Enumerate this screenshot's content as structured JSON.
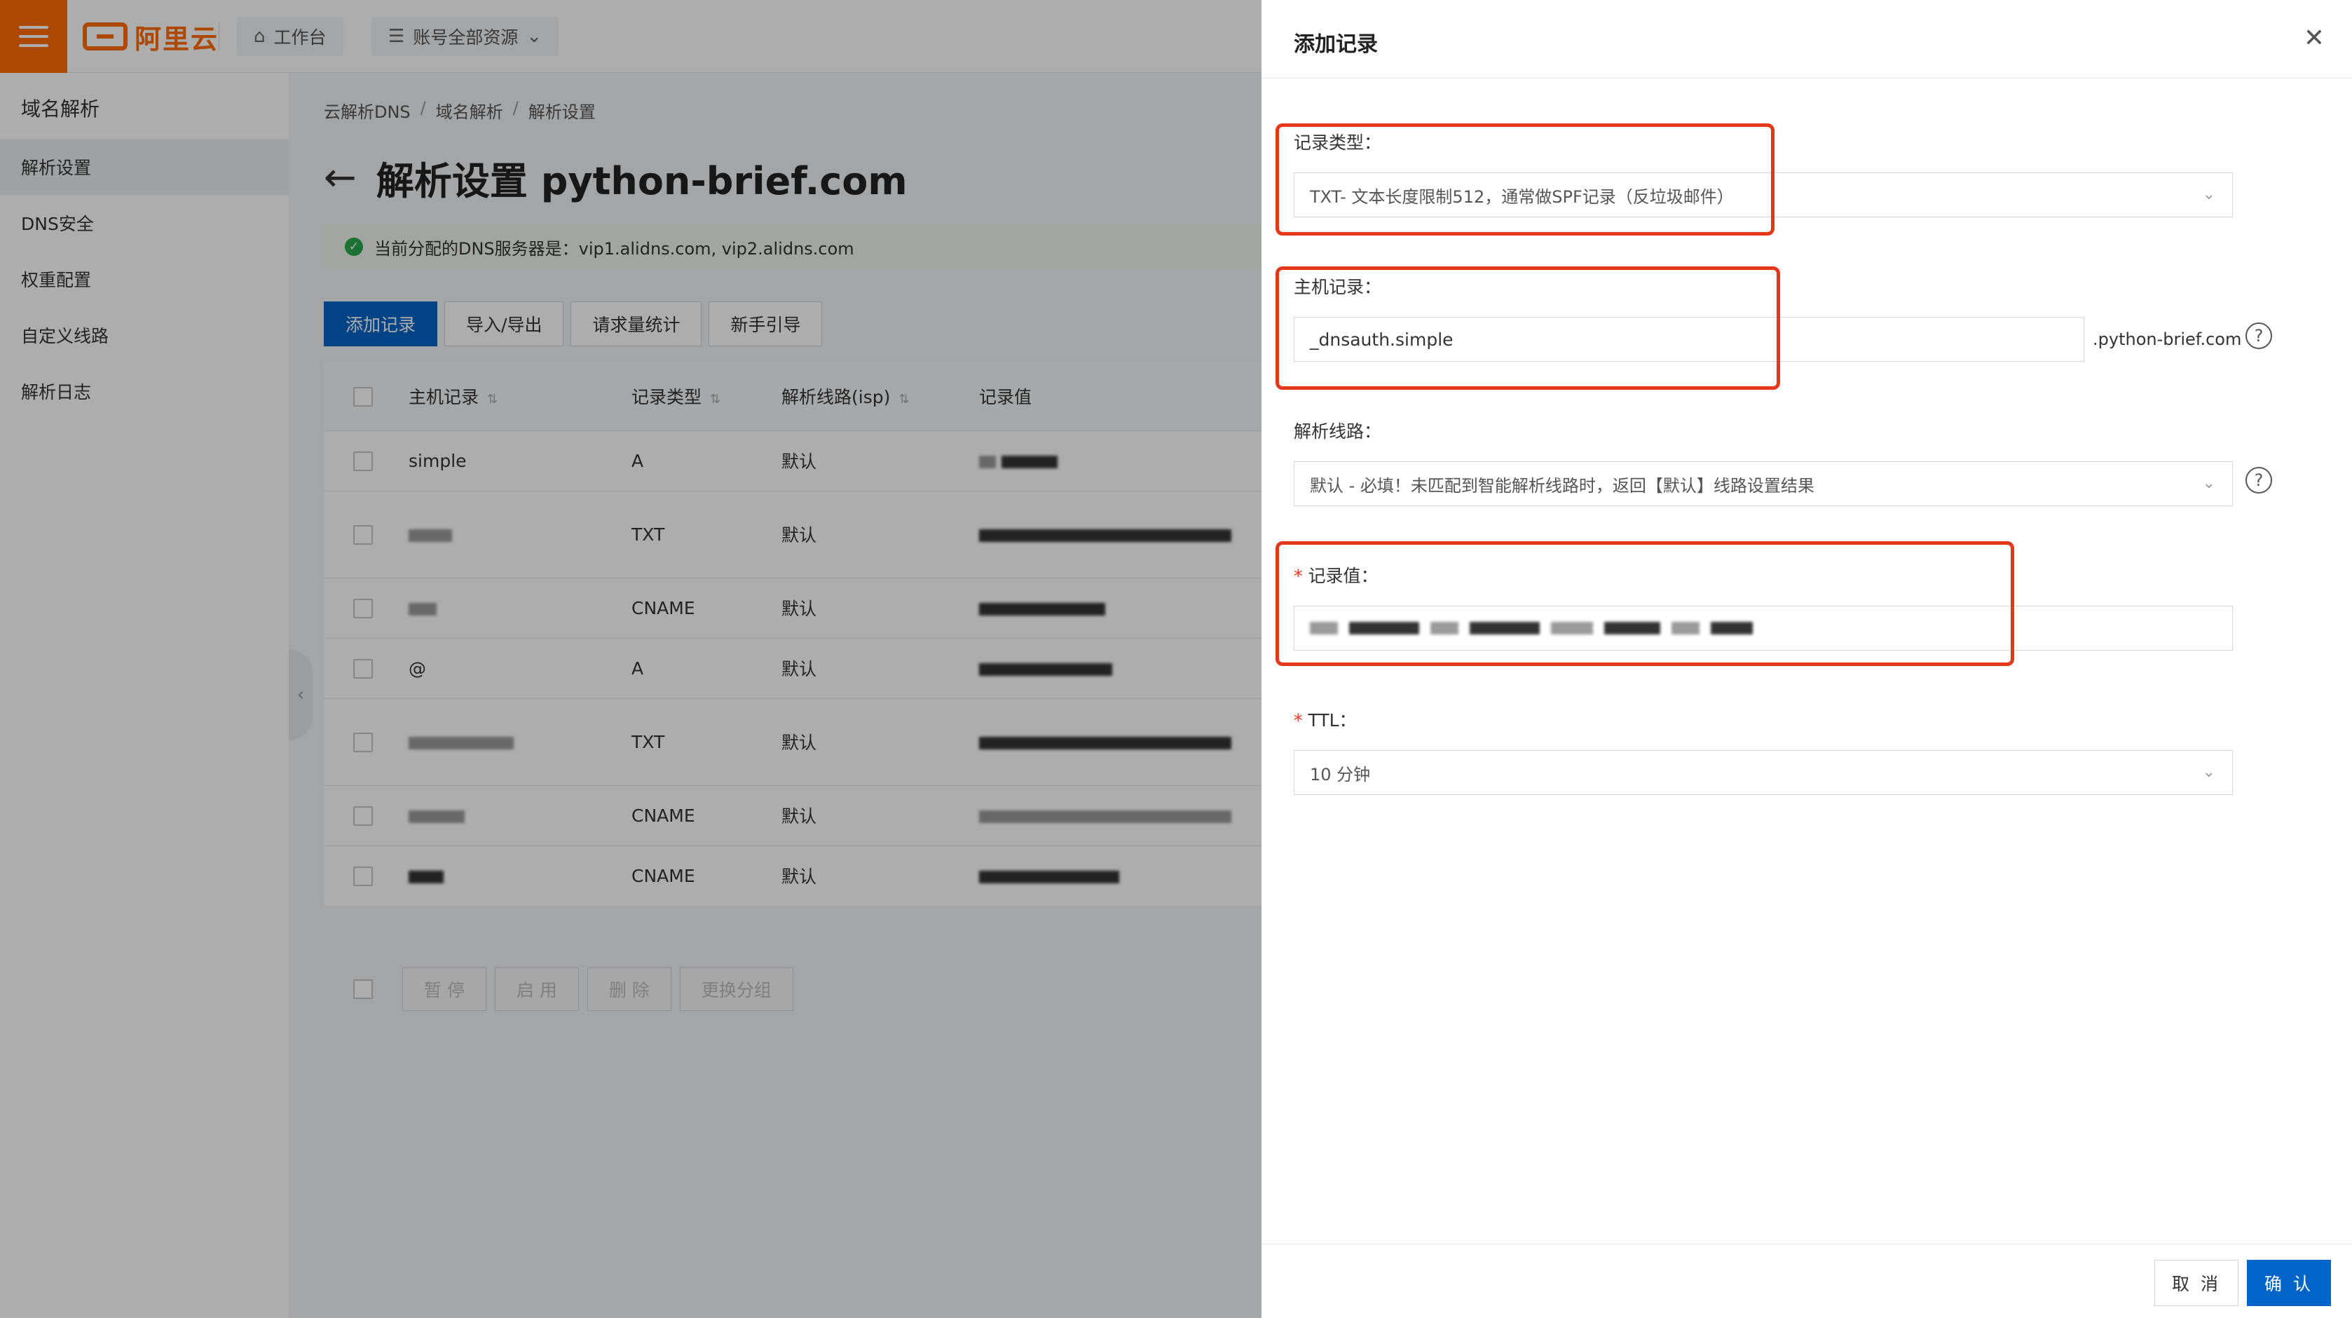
{
  "topbar": {
    "brand": "阿里云",
    "workbench": "工作台",
    "resources": "账号全部资源",
    "icons": {
      "menu": "hamburger-icon",
      "home": "home-icon",
      "server": "server-icon",
      "caret": "chevron-down-icon"
    }
  },
  "sidebar": {
    "title": "域名解析",
    "items": [
      {
        "label": "解析设置",
        "active": true
      },
      {
        "label": "DNS安全"
      },
      {
        "label": "权重配置"
      },
      {
        "label": "自定义线路"
      },
      {
        "label": "解析日志"
      }
    ]
  },
  "main": {
    "breadcrumb": [
      "云解析DNS",
      "域名解析",
      "解析设置"
    ],
    "title": "解析设置 python-brief.com",
    "dns_info": "当前分配的DNS服务器是：vip1.alidns.com, vip2.alidns.com",
    "actions": [
      "添加记录",
      "导入/导出",
      "请求量统计",
      "新手引导"
    ],
    "table": {
      "headers": [
        "主机记录",
        "记录类型",
        "解析线路(isp)",
        "记录值"
      ],
      "rows": [
        {
          "host": "simple",
          "type": "A",
          "line": "默认"
        },
        {
          "host": "",
          "type": "TXT",
          "line": "默认"
        },
        {
          "host": "",
          "type": "CNAME",
          "line": "默认"
        },
        {
          "host": "@",
          "type": "A",
          "line": "默认"
        },
        {
          "host": "",
          "type": "TXT",
          "line": "默认"
        },
        {
          "host": "",
          "type": "CNAME",
          "line": "默认"
        },
        {
          "host": "",
          "type": "CNAME",
          "line": "默认"
        }
      ]
    },
    "bulk_actions": [
      "暂 停",
      "启 用",
      "删 除",
      "更换分组"
    ]
  },
  "drawer": {
    "title": "添加记录",
    "record_type": {
      "label": "记录类型：",
      "value": "TXT- 文本长度限制512，通常做SPF记录（反垃圾邮件）"
    },
    "host": {
      "label": "主机记录：",
      "value": "_dnsauth.simple",
      "suffix": ".python-brief.com"
    },
    "line": {
      "label": "解析线路：",
      "value": "默认 - 必填！未匹配到智能解析线路时，返回【默认】线路设置结果"
    },
    "record_value": {
      "label": "记录值："
    },
    "ttl": {
      "label": "TTL：",
      "value": "10 分钟"
    },
    "cancel": "取 消",
    "confirm": "确 认"
  },
  "colors": {
    "brand": "#ff6a00",
    "primary": "#0064c8",
    "highlight": "#e5371a"
  }
}
